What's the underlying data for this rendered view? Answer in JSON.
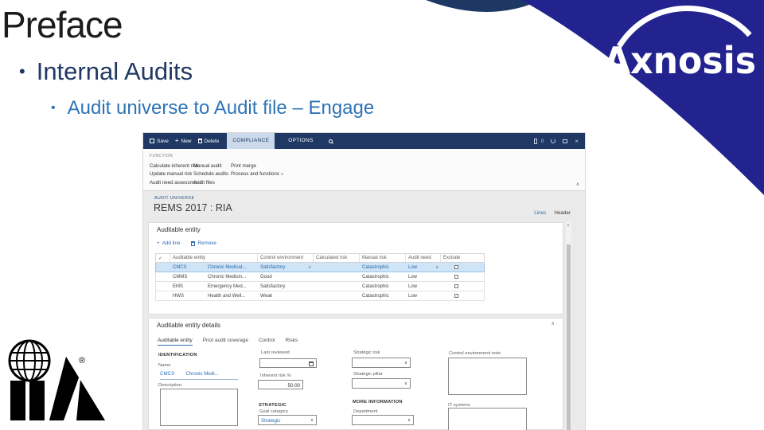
{
  "slide": {
    "title": "Preface",
    "bullets": {
      "level1": "Internal Audits",
      "level2": "Audit universe to Audit file – Engage"
    }
  },
  "brand": {
    "logo_text": "Axnosis",
    "iia_mark": "®"
  },
  "icons": {
    "bullet": "•",
    "select_all": "✓",
    "dropdown_caret": "∨",
    "collapse_chevron": "∧",
    "add": "+",
    "close": "×"
  },
  "colors": {
    "corner_blue": "#23238f",
    "navy": "#1f3864",
    "subtitle_blue": "#2e74b5",
    "accent_blue": "#2b6cb8",
    "selected_row": "#cfe4f7"
  },
  "app": {
    "titlebar": {
      "save_label": "Save",
      "new_label": "New",
      "delete_label": "Delete",
      "compliance_tab": "COMPLIANCE",
      "options_tab": "OPTIONS",
      "attachment_count": "0"
    },
    "ribbon": {
      "group_label": "FUNCTION",
      "column1": [
        "Calculate inherent risk",
        "Update manual risk",
        "Audit need assessment"
      ],
      "column2": [
        "Manual audit",
        "Schedule audits",
        "Audit files"
      ],
      "column3": [
        "Print merge",
        "Process and functions"
      ]
    },
    "page_header": {
      "caption": "AUDIT UNIVERSE",
      "title": "REMS 2017 : RIA",
      "links": [
        "Lines",
        "Header"
      ]
    },
    "grid_card": {
      "title": "Auditable entity",
      "toolbar": {
        "add_line": "Add line",
        "remove": "Remove"
      },
      "columns": [
        "Auditable entity",
        "Control environment",
        "Calculated risk",
        "Manual risk",
        "Audit need",
        "Exclude"
      ],
      "rows": [
        {
          "code": "CMCS",
          "name": "Chronic Medicat...",
          "control_environment": "Satisfactory",
          "calculated_risk": "",
          "manual_risk": "Catastrophic",
          "audit_need": "Low",
          "selected": true
        },
        {
          "code": "CMMS",
          "name": "Chronic Medicin...",
          "control_environment": "Good",
          "calculated_risk": "",
          "manual_risk": "Catastrophic",
          "audit_need": "Low",
          "selected": false
        },
        {
          "code": "EMS",
          "name": "Emergency Med...",
          "control_environment": "Satisfactory",
          "calculated_risk": "",
          "manual_risk": "Catastrophic",
          "audit_need": "Low",
          "selected": false
        },
        {
          "code": "HWS",
          "name": "Health and Well...",
          "control_environment": "Weak",
          "calculated_risk": "",
          "manual_risk": "Catastrophic",
          "audit_need": "Low",
          "selected": false
        }
      ]
    },
    "details_card": {
      "title": "Auditable entity details",
      "tabs": [
        "Auditable entity",
        "Prior audit coverage",
        "Control",
        "Risks"
      ],
      "sections": {
        "identification": "IDENTIFICATION",
        "strategic": "STRATEGIC",
        "more_information": "MORE INFORMATION"
      },
      "fields": {
        "name_label": "Name",
        "name_code": "CMCS",
        "name_text": "Chronic Medi...",
        "description_label": "Description",
        "last_reviewed_label": "Last reviewed",
        "inherent_risk_label": "Inherent risk %",
        "inherent_risk_value": "50.00",
        "goal_category_label": "Goal category",
        "goal_category_value": "Strategic",
        "strategic_risk_label": "Strategic risk",
        "strategic_pillar_label": "Strategic pillar",
        "department_label": "Department",
        "control_environment_note_label": "Control environment note",
        "it_systems_label": "IT systems"
      }
    }
  }
}
